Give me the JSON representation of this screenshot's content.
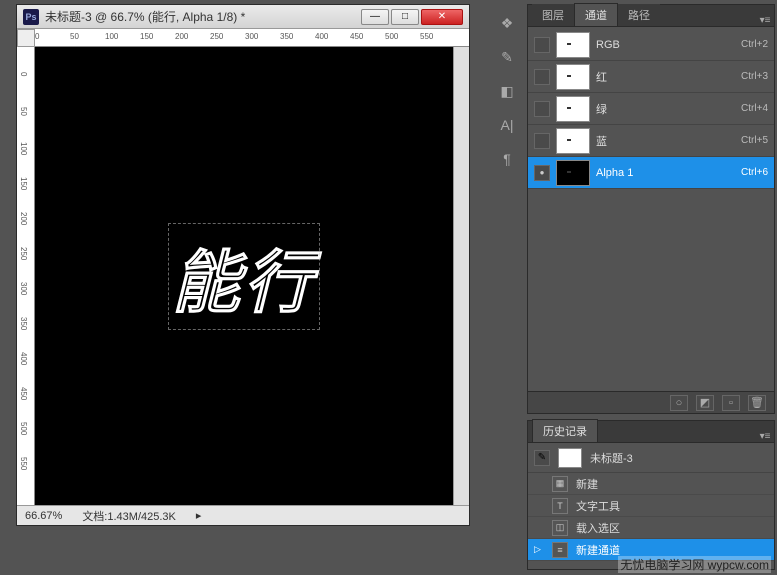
{
  "document": {
    "title": "未标题-3 @ 66.7% (能行, Alpha 1/8) *",
    "canvas_text": "能行",
    "zoom": "66.67%",
    "filesize": "文档:1.43M/425.3K"
  },
  "ruler_h": [
    "0",
    "50",
    "100",
    "150",
    "200",
    "250",
    "300",
    "350",
    "400",
    "450",
    "500",
    "550"
  ],
  "ruler_v": [
    "50",
    "0",
    "50",
    "100",
    "150",
    "200",
    "250",
    "300",
    "350",
    "400",
    "450",
    "500",
    "550"
  ],
  "window_controls": {
    "minimize": "—",
    "maximize": "□",
    "close": "✕"
  },
  "panels": {
    "channels": {
      "tabs": [
        "图层",
        "通道",
        "路径"
      ],
      "active_tab": 1,
      "items": [
        {
          "name": "RGB",
          "shortcut": "Ctrl+2",
          "visible": false,
          "thumb": "white",
          "selected": false
        },
        {
          "name": "红",
          "shortcut": "Ctrl+3",
          "visible": false,
          "thumb": "white",
          "selected": false
        },
        {
          "name": "绿",
          "shortcut": "Ctrl+4",
          "visible": false,
          "thumb": "white",
          "selected": false
        },
        {
          "name": "蓝",
          "shortcut": "Ctrl+5",
          "visible": false,
          "thumb": "white",
          "selected": false
        },
        {
          "name": "Alpha 1",
          "shortcut": "Ctrl+6",
          "visible": true,
          "thumb": "alpha",
          "selected": true
        }
      ],
      "footer_icons": [
        "load-selection",
        "save-selection",
        "new-channel",
        "delete-channel"
      ]
    },
    "history": {
      "title": "历史记录",
      "doc_name": "未标题-3",
      "items": [
        {
          "icon": "new",
          "label": "新建",
          "selected": false
        },
        {
          "icon": "text",
          "label": "文字工具",
          "selected": false
        },
        {
          "icon": "sel",
          "label": "载入选区",
          "selected": false
        },
        {
          "icon": "chan",
          "label": "新建通道",
          "selected": true
        }
      ]
    }
  },
  "vtoolbar": [
    "paragraph-icon",
    "brush-icon",
    "swatches-icon",
    "al-icon",
    "pilcrow-icon"
  ],
  "watermark": "无忧电脑学习网\nwypcw.com"
}
